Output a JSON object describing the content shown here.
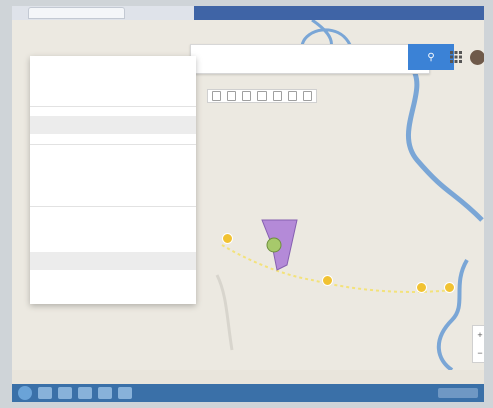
{
  "app": {
    "window_title": "",
    "search": {
      "placeholder": "",
      "value": ""
    },
    "search_button_label": ""
  },
  "panel": {
    "title": "",
    "subtitle": "",
    "layer_name": "",
    "items": [
      "",
      ""
    ],
    "section2_title": "",
    "section2_items": [
      "",
      ""
    ]
  },
  "map": {
    "labels": [
      "",
      "",
      ""
    ]
  },
  "colors": {
    "panel_bg": "#ffffff",
    "map_bg": "#ece9e1",
    "river": "#7aa6d6",
    "accent_blue": "#3b82d6",
    "marker_yellow": "#f1c232",
    "polygon_purple": "#b48ad8"
  }
}
